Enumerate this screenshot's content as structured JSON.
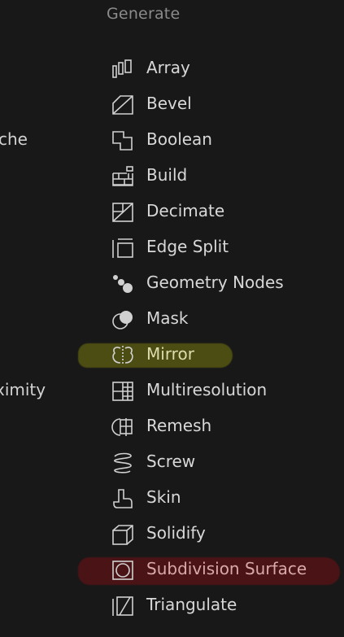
{
  "menu": {
    "header": "Generate",
    "left_fragments": [
      "che",
      "ximity"
    ],
    "items": [
      {
        "label": "Array",
        "icon": "array-icon"
      },
      {
        "label": "Bevel",
        "icon": "bevel-icon"
      },
      {
        "label": "Boolean",
        "icon": "boolean-icon"
      },
      {
        "label": "Build",
        "icon": "build-icon"
      },
      {
        "label": "Decimate",
        "icon": "decimate-icon"
      },
      {
        "label": "Edge Split",
        "icon": "edge-split-icon"
      },
      {
        "label": "Geometry Nodes",
        "icon": "geometry-nodes-icon"
      },
      {
        "label": "Mask",
        "icon": "mask-icon"
      },
      {
        "label": "Mirror",
        "icon": "mirror-icon",
        "highlight": "#4c4d12"
      },
      {
        "label": "Multiresolution",
        "icon": "multiresolution-icon"
      },
      {
        "label": "Remesh",
        "icon": "remesh-icon"
      },
      {
        "label": "Screw",
        "icon": "screw-icon"
      },
      {
        "label": "Skin",
        "icon": "skin-icon"
      },
      {
        "label": "Solidify",
        "icon": "solidify-icon"
      },
      {
        "label": "Subdivision Surface",
        "icon": "subdivision-surface-icon",
        "highlight": "#4a1416"
      },
      {
        "label": "Triangulate",
        "icon": "triangulate-icon"
      }
    ]
  }
}
